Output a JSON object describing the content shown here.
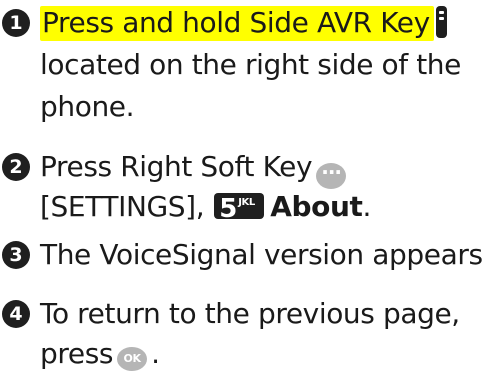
{
  "steps": [
    {
      "number": "1",
      "highlight": "Press and hold Side AVR Key",
      "line2": "located on the right side of the",
      "line3": "phone.",
      "icon": "side-avr-key-icon"
    },
    {
      "number": "2",
      "line1": "Press Right Soft Key",
      "line2_a": "[SETTINGS],",
      "key_digit": "5",
      "key_letters": "JKL",
      "line2_bold": "About",
      "line2_end": ".",
      "icons": [
        "right-soft-key-icon",
        "key-5-icon"
      ]
    },
    {
      "number": "3",
      "line1": "The VoiceSignal version appears."
    },
    {
      "number": "4",
      "line1": "To return to the previous page,",
      "line2_a": "press",
      "ok_label": "OK",
      "line2_end": ".",
      "icon": "ok-key-icon"
    }
  ],
  "colors": {
    "highlight": "#ffff00",
    "text": "#1a1a1a",
    "icon_dark": "#1f1f1f",
    "icon_gray": "#b5b5b5"
  }
}
